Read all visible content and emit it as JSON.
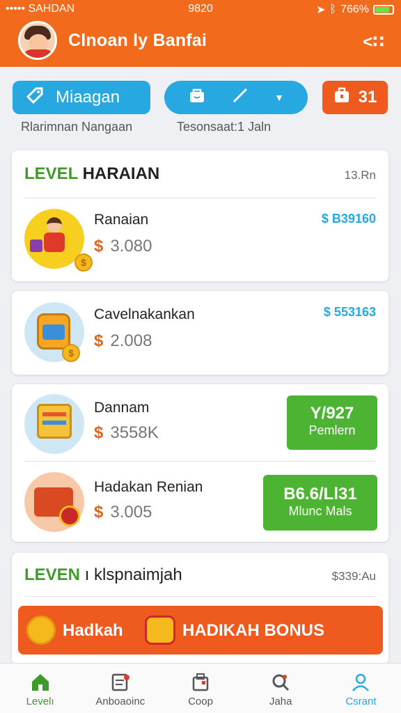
{
  "status_bar": {
    "carrier": "••••• SAHDAN",
    "time": "9820",
    "battery": "766%"
  },
  "header": {
    "title": "Clnoan ly Banfai",
    "menu_icon": "menu-dots-icon"
  },
  "actions": {
    "primary_label": "Miaagan",
    "badge_value": "31",
    "sub_left": "Rlarimnan Nangaan",
    "sub_right": "Tesonsaat:1 Jaln"
  },
  "section1": {
    "title_green": "LEVEL",
    "title_dark": "HARAIAN",
    "meta": "13.Rn",
    "items": [
      {
        "name": "Ranaian",
        "amount": "3.080",
        "price": "$ B39160"
      },
      {
        "name": "Cavelnakankan",
        "amount": "2.008",
        "price": "$ 553163"
      }
    ]
  },
  "section2": {
    "items": [
      {
        "name": "Dannam",
        "amount": "3558K",
        "btn_big": "Y/927",
        "btn_small": "Pemlern"
      },
      {
        "name": "Hadakan Renian",
        "amount": "3.005",
        "btn_big": "B6.6/Ll31",
        "btn_small": "Mlunc Mals"
      }
    ]
  },
  "section3": {
    "title_green": "LEVEN",
    "title_dark": "ı klspnaimjah",
    "meta": "$339:Au"
  },
  "bonus": {
    "left_label": "Hadkah",
    "right_label": "HADIKAH BONUS"
  },
  "nav": [
    {
      "label": "Levelı",
      "icon": "home-icon"
    },
    {
      "label": "Anboaoinc",
      "icon": "task-icon"
    },
    {
      "label": "Coop",
      "icon": "shop-icon"
    },
    {
      "label": "Jaha",
      "icon": "search-icon"
    },
    {
      "label": "Csrant",
      "icon": "user-icon"
    }
  ],
  "colors": {
    "accent": "#f26a1b",
    "blue": "#27a8e0",
    "green": "#4cb432"
  }
}
